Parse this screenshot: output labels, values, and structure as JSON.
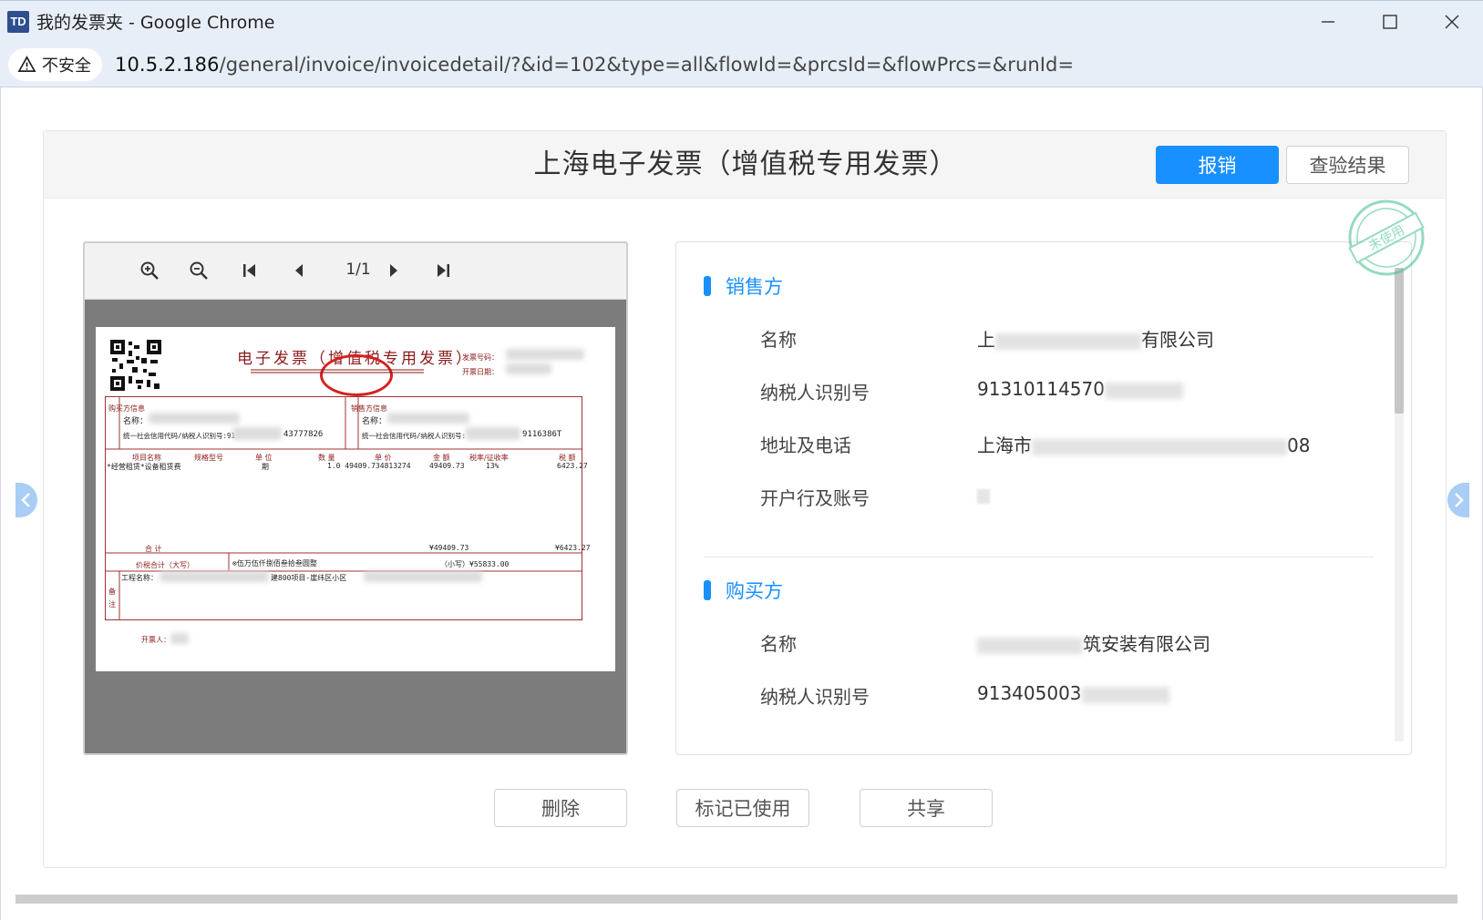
{
  "window": {
    "app_icon_text": "TD",
    "title": "我的发票夹 - Google Chrome",
    "security_label": "不安全",
    "url_host": "10.5.2.186",
    "url_path": "/general/invoice/invoicedetail/?&id=102&type=all&flowId=&prcsId=&flowPrcs=&runId="
  },
  "header": {
    "title": "上海电子发票（增值税专用发票）",
    "reimburse_label": "报销",
    "verify_label": "查验结果"
  },
  "viewer": {
    "page_indicator": "1/1",
    "icons": [
      "zoom-in-icon",
      "zoom-out-icon",
      "first-page-icon",
      "prev-page-icon",
      "next-page-icon",
      "last-page-icon"
    ]
  },
  "invoice_image": {
    "title": "电子发票（增值税专用发票）",
    "invoice_code_label": "发票号码：",
    "issue_date_label": "开票日期：",
    "buyer_name_label": "名称：",
    "buyer_id_label": "统一社会信用代码/纳税人识别号:91",
    "buyer_id_tail": "43777826",
    "seller_name_label": "名称：",
    "seller_id_label": "统一社会信用代码/纳税人识别号:",
    "seller_id_tail": "9116386T",
    "col_item": "项目名称",
    "col_spec": "规格型号",
    "col_unit": "单 位",
    "col_qty": "数 量",
    "col_price": "单 价",
    "col_amount": "金 额",
    "col_rate": "税率/征收率",
    "col_tax": "税 额",
    "item_name": "*经营租赁*设备租赁费",
    "item_unit": "期",
    "item_qty_price": "1.0 49409.734813274",
    "item_amount": "49409.73",
    "item_rate": "13%",
    "item_tax": "6423.27",
    "total_label": "合 计",
    "total_amount": "¥49409.73",
    "total_tax": "¥6423.27",
    "total_words_label": "价税合计（大写）",
    "total_words": "⊗伍万伍仟捌佰叁拾叁圆整",
    "total_small": "（小写）¥55833.00",
    "remark_label": "备注",
    "remark_text": "工程名称：",
    "remark_text2": "建800项目-崖纬区小区",
    "issuer_label": "开票人：",
    "buyer_side": "购买方信息",
    "seller_side": "销售方信息"
  },
  "seller": {
    "section_title": "销售方",
    "name_label": "名称",
    "name_value_head": "上",
    "name_value_tail": "有限公司",
    "tax_id_label": "纳税人识别号",
    "tax_id_value": "91310114570",
    "address_label": "地址及电话",
    "address_value_head": "上海市",
    "address_value_tail": "08",
    "bank_label": "开户行及账号"
  },
  "buyer": {
    "section_title": "购买方",
    "name_label": "名称",
    "name_value_tail": "筑安装有限公司",
    "tax_id_label": "纳税人识别号",
    "tax_id_value": "913405003"
  },
  "status_stamp": "未使用",
  "actions": {
    "delete_label": "删除",
    "mark_used_label": "标记已使用",
    "share_label": "共享"
  },
  "colors": {
    "primary": "#1890ff",
    "invoice_red": "#8b1a1a",
    "stamp_green": "#3fbf8a"
  }
}
